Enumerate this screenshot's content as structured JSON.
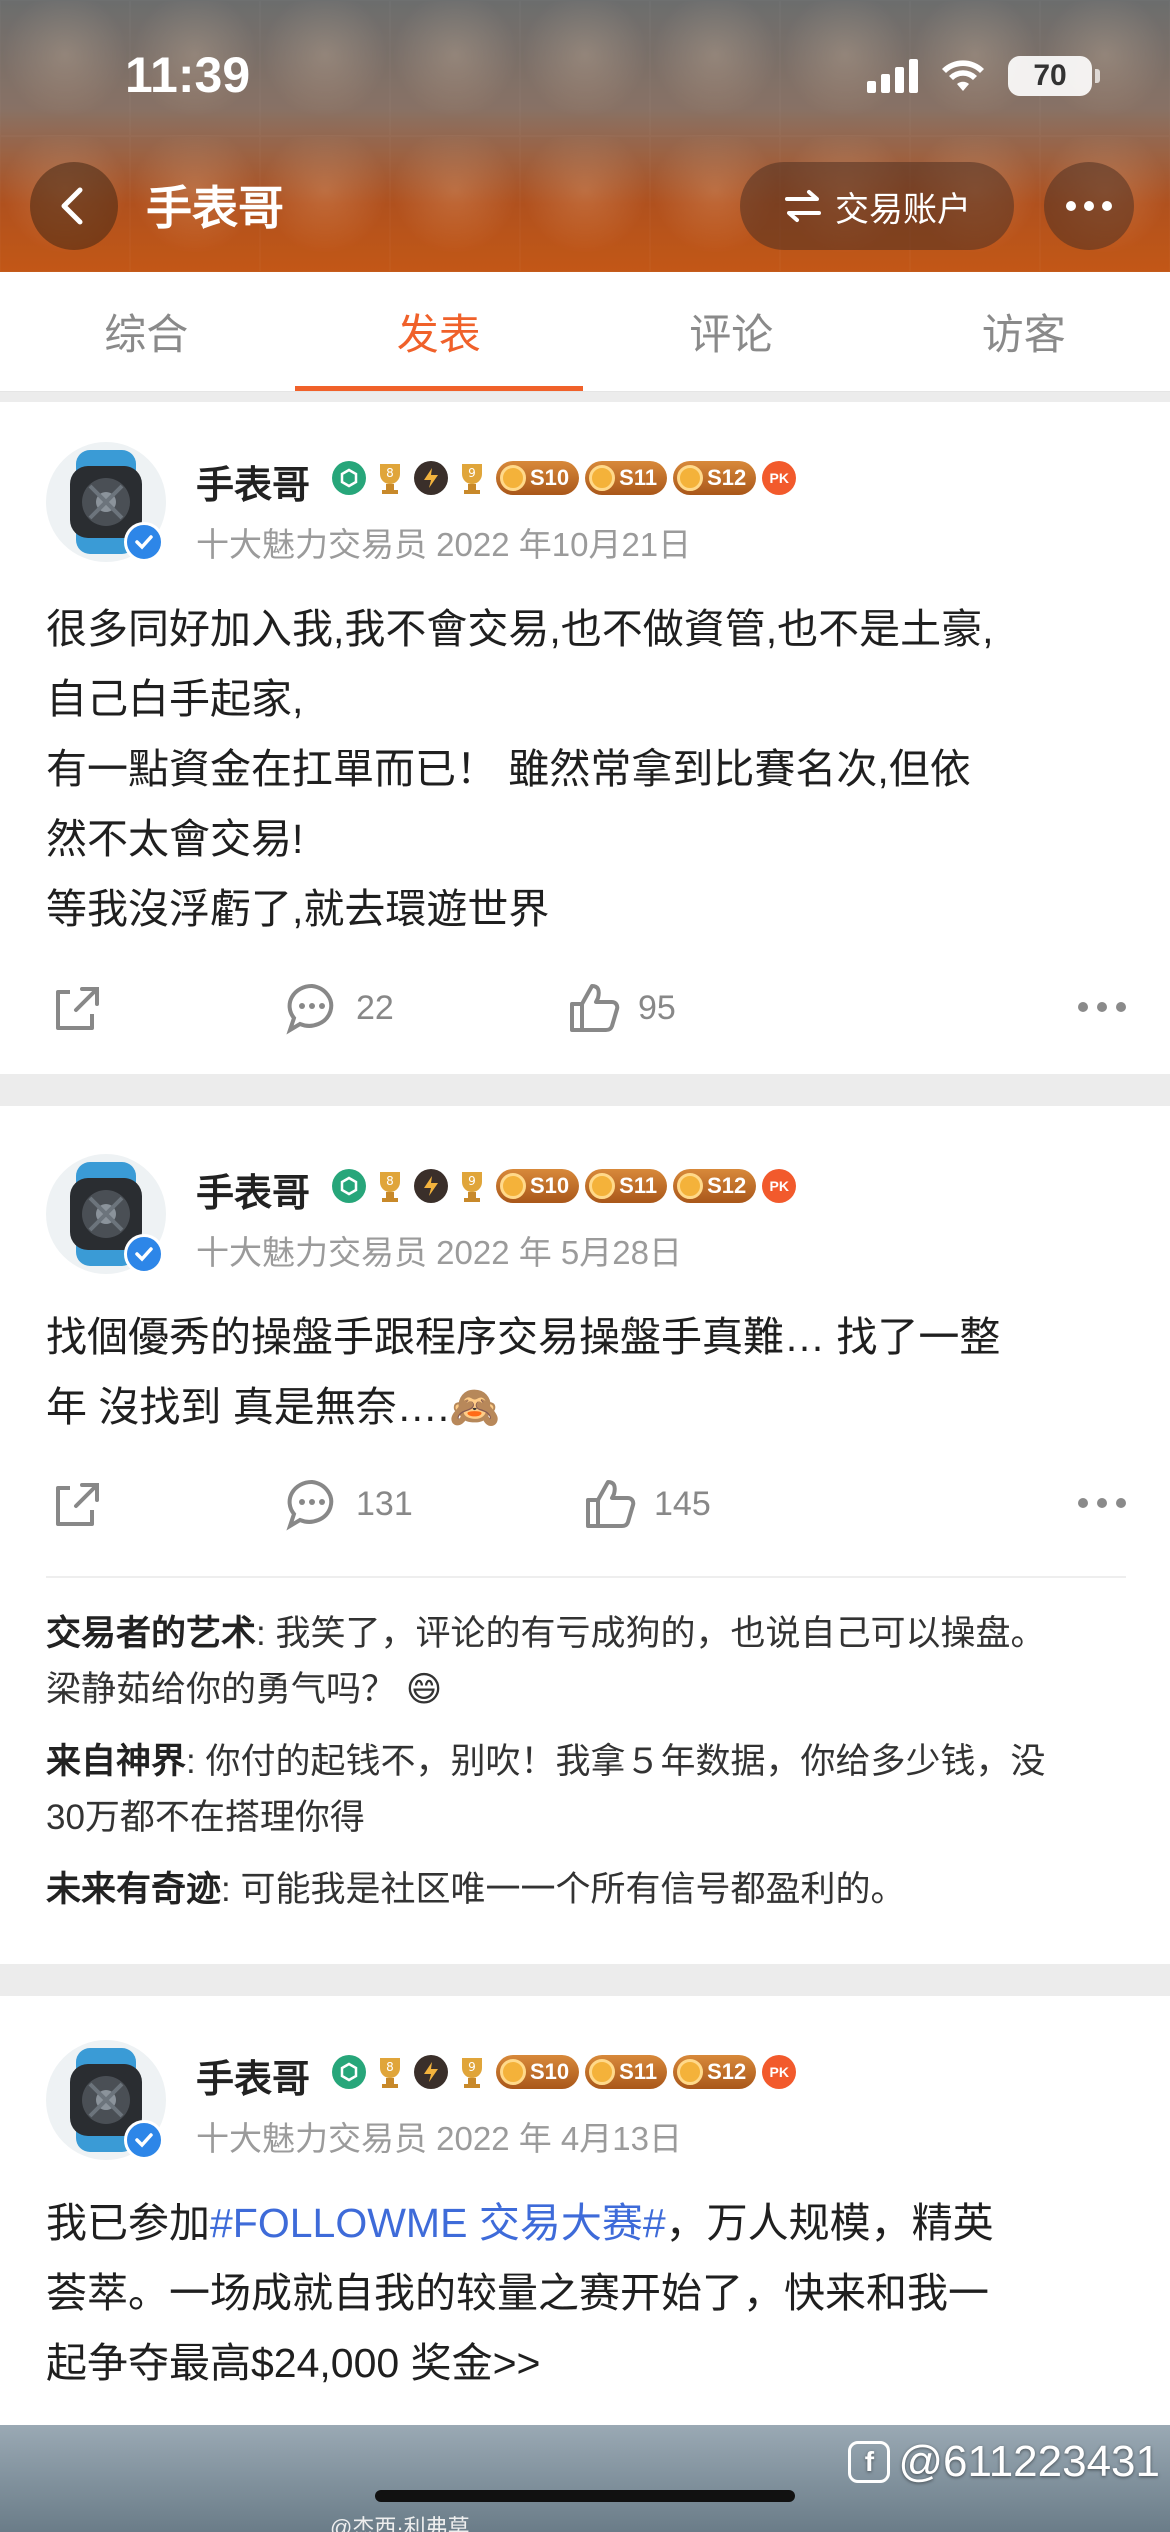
{
  "status_bar": {
    "time": "11:39",
    "battery": "70"
  },
  "header": {
    "title": "手表哥",
    "trade_label": "交易账户"
  },
  "tabs": [
    {
      "label": "综合"
    },
    {
      "label": "发表"
    },
    {
      "label": "评论"
    },
    {
      "label": "访客"
    }
  ],
  "posts": [
    {
      "name": "手表哥",
      "meta": "十大魅力交易员 2022 年10月21日",
      "body": "很多同好加入我,我不會交易,也不做資管,也不是土豪,\n自己白手起家,\n有一點資金在扛單而已！ 雖然常拿到比賽名次,但依\n然不太會交易!\n等我沒浮虧了,就去環遊世界",
      "comments_count": "22",
      "likes_count": "95"
    },
    {
      "name": "手表哥",
      "meta": "十大魅力交易员 2022 年 5月28日",
      "body": "找個優秀的操盤手跟程序交易操盤手真難… 找了一整\n年 沒找到 真是無奈….🙈",
      "comments_count": "131",
      "likes_count": "145",
      "comments": [
        {
          "author": "交易者的艺术",
          "text": ": 我笑了，评论的有亏成狗的，也说自己可以操盘。\n梁静茹给你的勇气吗？ 😄"
        },
        {
          "author": "来自神界",
          "text": ": 你付的起钱不，别吹！我拿５年数据，你给多少钱，没\n30万都不在搭理你得"
        },
        {
          "author": "未来有奇迹",
          "text": ": 可能我是社区唯一一个所有信号都盈利的。"
        }
      ]
    },
    {
      "name": "手表哥",
      "meta": "十大魅力交易员 2022 年 4月13日",
      "body_prefix": "我已参加",
      "body_tag": "#FOLLOWME 交易大赛#",
      "body_suffix": "，万人规模，精英\n荟萃。一场成就自我的较量之赛开始了，快来和我一\n起争夺最高$24,000 奖金>>"
    }
  ],
  "badges": {
    "b1": "8",
    "b2": "9",
    "s1": "S10",
    "s2": "S11",
    "s3": "S12",
    "pk": "PK"
  },
  "footer": {
    "watermark": "@611223431",
    "caption": "@杰西·利弗莫"
  },
  "colors": {
    "accent": "#f0612a",
    "tag": "#3e6bd9",
    "verified": "#2d86e8"
  }
}
